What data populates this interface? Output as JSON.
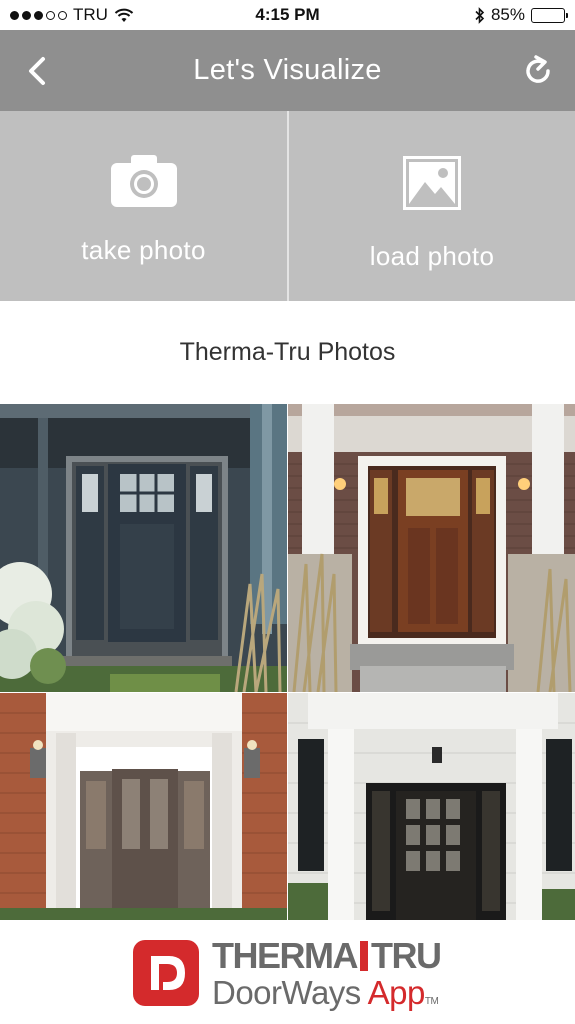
{
  "status_bar": {
    "carrier": "TRU",
    "time": "4:15 PM",
    "battery": "85%",
    "battery_level": 0.85,
    "signal_bars_filled": 3,
    "signal_bars_total": 5
  },
  "nav": {
    "title": "Let's Visualize",
    "back_icon": "chevron-left-icon",
    "refresh_icon": "refresh-icon"
  },
  "actions": {
    "take_photo": {
      "label": "take photo",
      "icon": "camera-icon"
    },
    "load_photo": {
      "label": "load photo",
      "icon": "image-icon"
    }
  },
  "section": {
    "title": "Therma-Tru Photos"
  },
  "gallery": {
    "photos": [
      {
        "name": "slate-gray-craftsman-door-photo"
      },
      {
        "name": "mahogany-craftsman-door-photo"
      },
      {
        "name": "taupe-decorative-glass-door-photo"
      },
      {
        "name": "black-full-glass-door-photo"
      }
    ]
  },
  "footer": {
    "brand_left": "THERMA",
    "brand_right": "TRU",
    "app_name_left": "DoorWays ",
    "app_name_accent": "App",
    "trademark": "TM"
  },
  "colors": {
    "nav_background": "#8f8f8f",
    "action_background": "#bfbfbf",
    "brand_red": "#d42a2c",
    "brand_gray": "#6a6a6a"
  }
}
